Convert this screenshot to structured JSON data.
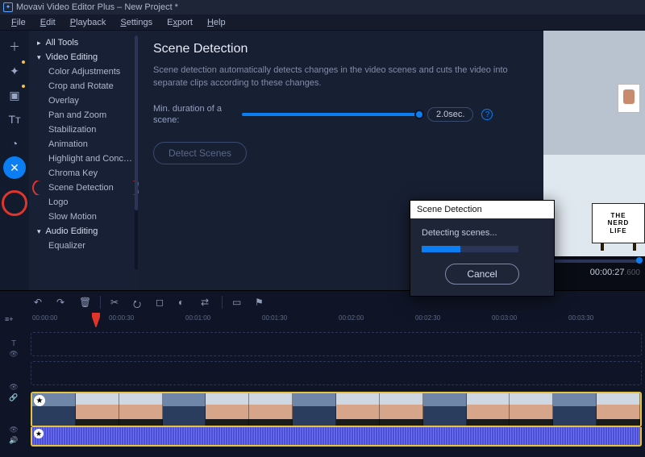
{
  "titlebar": {
    "app": "Movavi Video Editor Plus",
    "project": "New Project *"
  },
  "menubar": [
    "File",
    "Edit",
    "Playback",
    "Settings",
    "Export",
    "Help"
  ],
  "iconrail": [
    {
      "name": "add-media-icon",
      "glyph": "＋",
      "dot": false
    },
    {
      "name": "filters-icon",
      "glyph": "✦",
      "dot": true
    },
    {
      "name": "transitions-icon",
      "glyph": "▣",
      "dot": true
    },
    {
      "name": "titles-icon",
      "glyph": "Tᴛ",
      "dot": false
    },
    {
      "name": "stickers-icon",
      "glyph": "◔",
      "dot": false
    },
    {
      "name": "more-tools-icon",
      "glyph": "✕",
      "dot": false,
      "selected": true
    }
  ],
  "toolpanel": {
    "all_tools": "All Tools",
    "video_editing": "Video Editing",
    "video_items": [
      "Color Adjustments",
      "Crop and Rotate",
      "Overlay",
      "Pan and Zoom",
      "Stabilization",
      "Animation",
      "Highlight and Conc…",
      "Chroma Key",
      "Scene Detection",
      "Logo",
      "Slow Motion"
    ],
    "selected": "Scene Detection",
    "audio_editing": "Audio Editing",
    "audio_items": [
      "Equalizer"
    ]
  },
  "center": {
    "title": "Scene Detection",
    "desc": "Scene detection automatically detects changes in the video scenes and cuts the video into separate clips according to these changes.",
    "min_label": "Min. duration of a scene:",
    "value": "2.0sec.",
    "detect": "Detect Scenes"
  },
  "preview": {
    "sign_text": "THE\nNERD\nLIFE",
    "timecode": "00:00:27",
    "timecode_ms": ".600"
  },
  "toolbar_icons": {
    "undo": "↶",
    "redo": "↷",
    "delete": "🗑",
    "cut": "✂",
    "rotate": "⭮",
    "crop": "◻",
    "adjust": "◐",
    "color": "⇄",
    "record": "▭",
    "marker": "⚑"
  },
  "ruler": [
    "00:00:00",
    "00:00:30",
    "00:01:00",
    "00:01:30",
    "00:02:00",
    "00:02:30",
    "00:03:00",
    "00:03:30"
  ],
  "dialog": {
    "title": "Scene Detection",
    "msg": "Detecting scenes...",
    "cancel": "Cancel"
  }
}
